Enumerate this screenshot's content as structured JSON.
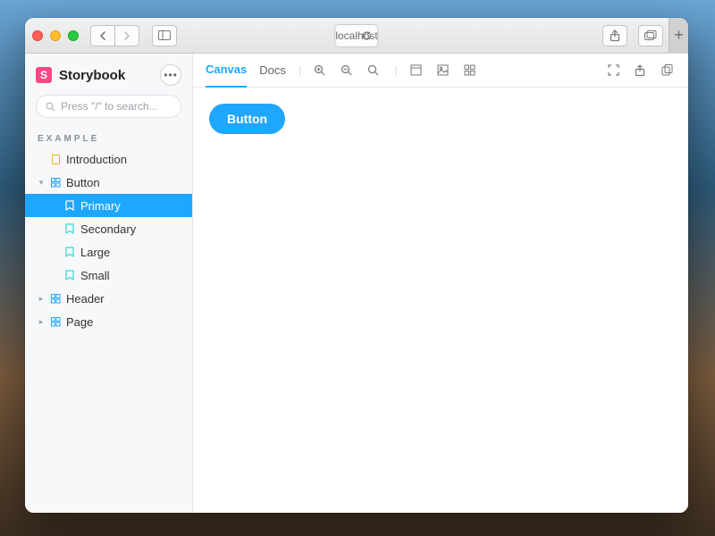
{
  "browser": {
    "url": "localhost"
  },
  "storybook": {
    "brand": "Storybook",
    "search_placeholder": "Press \"/\" to search...",
    "section_label": "EXAMPLE",
    "tree": {
      "introduction": "Introduction",
      "button": "Button",
      "button_children": {
        "primary": "Primary",
        "secondary": "Secondary",
        "large": "Large",
        "small": "Small"
      },
      "header": "Header",
      "page": "Page"
    }
  },
  "tabs": {
    "canvas": "Canvas",
    "docs": "Docs"
  },
  "preview": {
    "button_label": "Button"
  }
}
